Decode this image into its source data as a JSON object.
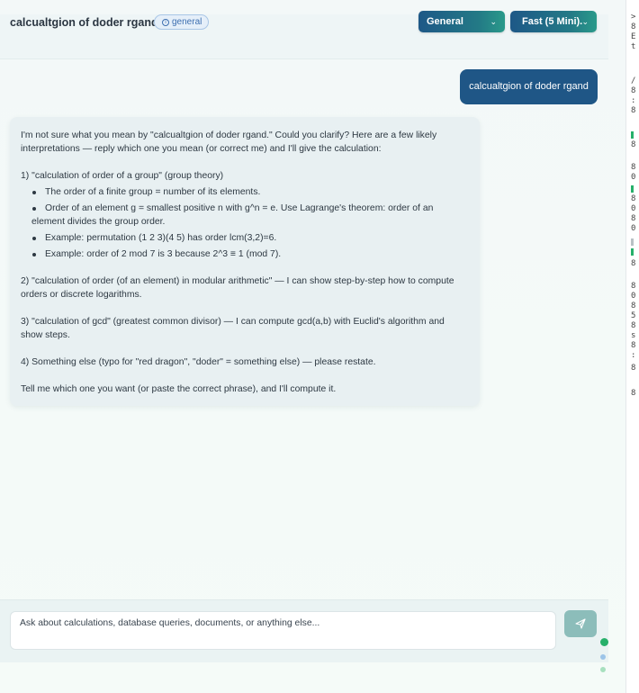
{
  "header": {
    "title": "calcualtgion of doder rgand",
    "tag": "general",
    "mode_select": "General",
    "speed_select": "Fast (5 Mini)."
  },
  "conversation": {
    "user_message": "calcualtgion of doder rgand",
    "assistant": {
      "intro": "I'm not sure what you mean by \"calcualtgion of doder rgand.\" Could you clarify? Here are a few likely interpretations — reply which one you mean (or correct me) and I'll give the calculation:",
      "option1_heading": "1) \"calculation of order of a group\" (group theory)",
      "option1_bullets": [
        "The order of a finite group = number of its elements.",
        "Order of an element g = smallest positive n with g^n = e. Use Lagrange's theorem: order of an element divides the group order.",
        "Example: permutation (1 2 3)(4 5) has order lcm(3,2)=6.",
        "Example: order of 2 mod 7 is 3 because 2^3 ≡ 1 (mod 7)."
      ],
      "option2": "2) \"calculation of order (of an element) in modular arithmetic\" — I can show step-by-step how to compute orders or discrete logarithms.",
      "option3": "3) \"calculation of gcd\" (greatest common divisor) — I can compute gcd(a,b) with Euclid's algorithm and show steps.",
      "option4": "4) Something else (typo for \"red dragon\", \"doder\" = something else) — please restate.",
      "closing": "Tell me which one you want (or paste the correct phrase), and I'll compute it."
    }
  },
  "composer": {
    "placeholder": "Ask about calculations, database queries, documents, or anything else..."
  },
  "side_panel": {
    "lines": [
      ">",
      "8",
      "E",
      "t",
      "/",
      "8",
      ":",
      "8",
      "8",
      "8",
      "0",
      "8",
      "0",
      "8",
      "0",
      "8",
      "8",
      "0",
      "8",
      "5",
      "8",
      "s",
      "8",
      ":",
      "8",
      "8"
    ]
  },
  "colors": {
    "primary": "#1f5686",
    "accent": "#2a9a8a",
    "send_button": "#8cbdba",
    "status_green": "#27b06a",
    "status_blue": "#9cc4e8"
  }
}
